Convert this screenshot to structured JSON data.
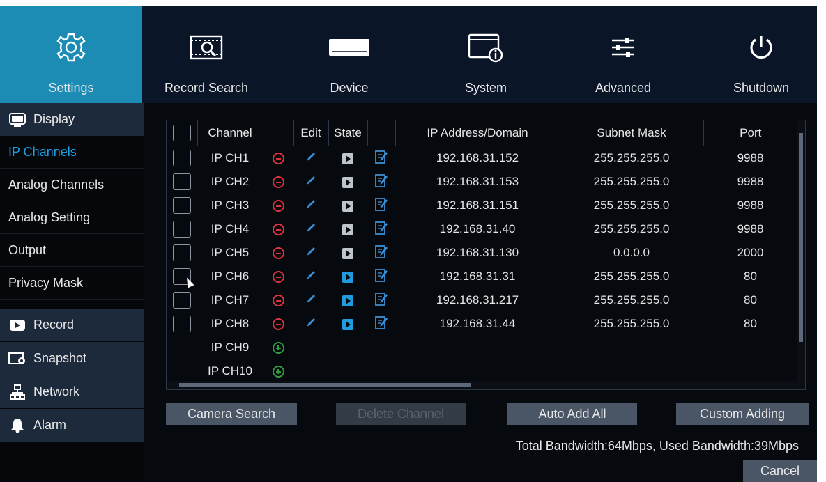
{
  "nav": [
    {
      "label": "Settings",
      "icon": "gear-icon"
    },
    {
      "label": "Record Search",
      "icon": "record-search-icon"
    },
    {
      "label": "Device",
      "icon": "hard-disk-icon"
    },
    {
      "label": "System",
      "icon": "system-info-icon"
    },
    {
      "label": "Advanced",
      "icon": "sliders-icon"
    },
    {
      "label": "Shutdown",
      "icon": "power-icon"
    }
  ],
  "sidebar": {
    "display": "Display",
    "items": [
      "IP Channels",
      "Analog Channels",
      "Analog Setting",
      "Output",
      "Privacy Mask"
    ],
    "record": "Record",
    "snapshot": "Snapshot",
    "network": "Network",
    "alarm": "Alarm"
  },
  "table": {
    "headers": [
      "Channel",
      "Edit",
      "State",
      "IP Address/Domain",
      "Subnet Mask",
      "Port"
    ],
    "rows": [
      {
        "channel": "IP CH1",
        "ip": "192.168.31.152",
        "mask": "255.255.255.0",
        "port": "9988",
        "state": "off"
      },
      {
        "channel": "IP CH2",
        "ip": "192.168.31.153",
        "mask": "255.255.255.0",
        "port": "9988",
        "state": "off"
      },
      {
        "channel": "IP CH3",
        "ip": "192.168.31.151",
        "mask": "255.255.255.0",
        "port": "9988",
        "state": "off"
      },
      {
        "channel": "IP CH4",
        "ip": "192.168.31.40",
        "mask": "255.255.255.0",
        "port": "9988",
        "state": "off"
      },
      {
        "channel": "IP CH5",
        "ip": "192.168.31.130",
        "mask": "0.0.0.0",
        "port": "2000",
        "state": "off"
      },
      {
        "channel": "IP CH6",
        "ip": "192.168.31.31",
        "mask": "255.255.255.0",
        "port": "80",
        "state": "on"
      },
      {
        "channel": "IP CH7",
        "ip": "192.168.31.217",
        "mask": "255.255.255.0",
        "port": "80",
        "state": "on"
      },
      {
        "channel": "IP CH8",
        "ip": "192.168.31.44",
        "mask": "255.255.255.0",
        "port": "80",
        "state": "on"
      }
    ],
    "empty_rows": [
      "IP CH9",
      "IP CH10"
    ]
  },
  "buttons": {
    "camera_search": "Camera Search",
    "delete_channel": "Delete Channel",
    "auto_add_all": "Auto Add All",
    "custom_adding": "Custom Adding",
    "cancel": "Cancel"
  },
  "bandwidth": "Total Bandwidth:64Mbps, Used Bandwidth:39Mbps",
  "colors": {
    "accent": "#1c8cb5",
    "selected_text": "#1e9fe0",
    "remove": "#e0323c",
    "add": "#2f9a3b"
  }
}
